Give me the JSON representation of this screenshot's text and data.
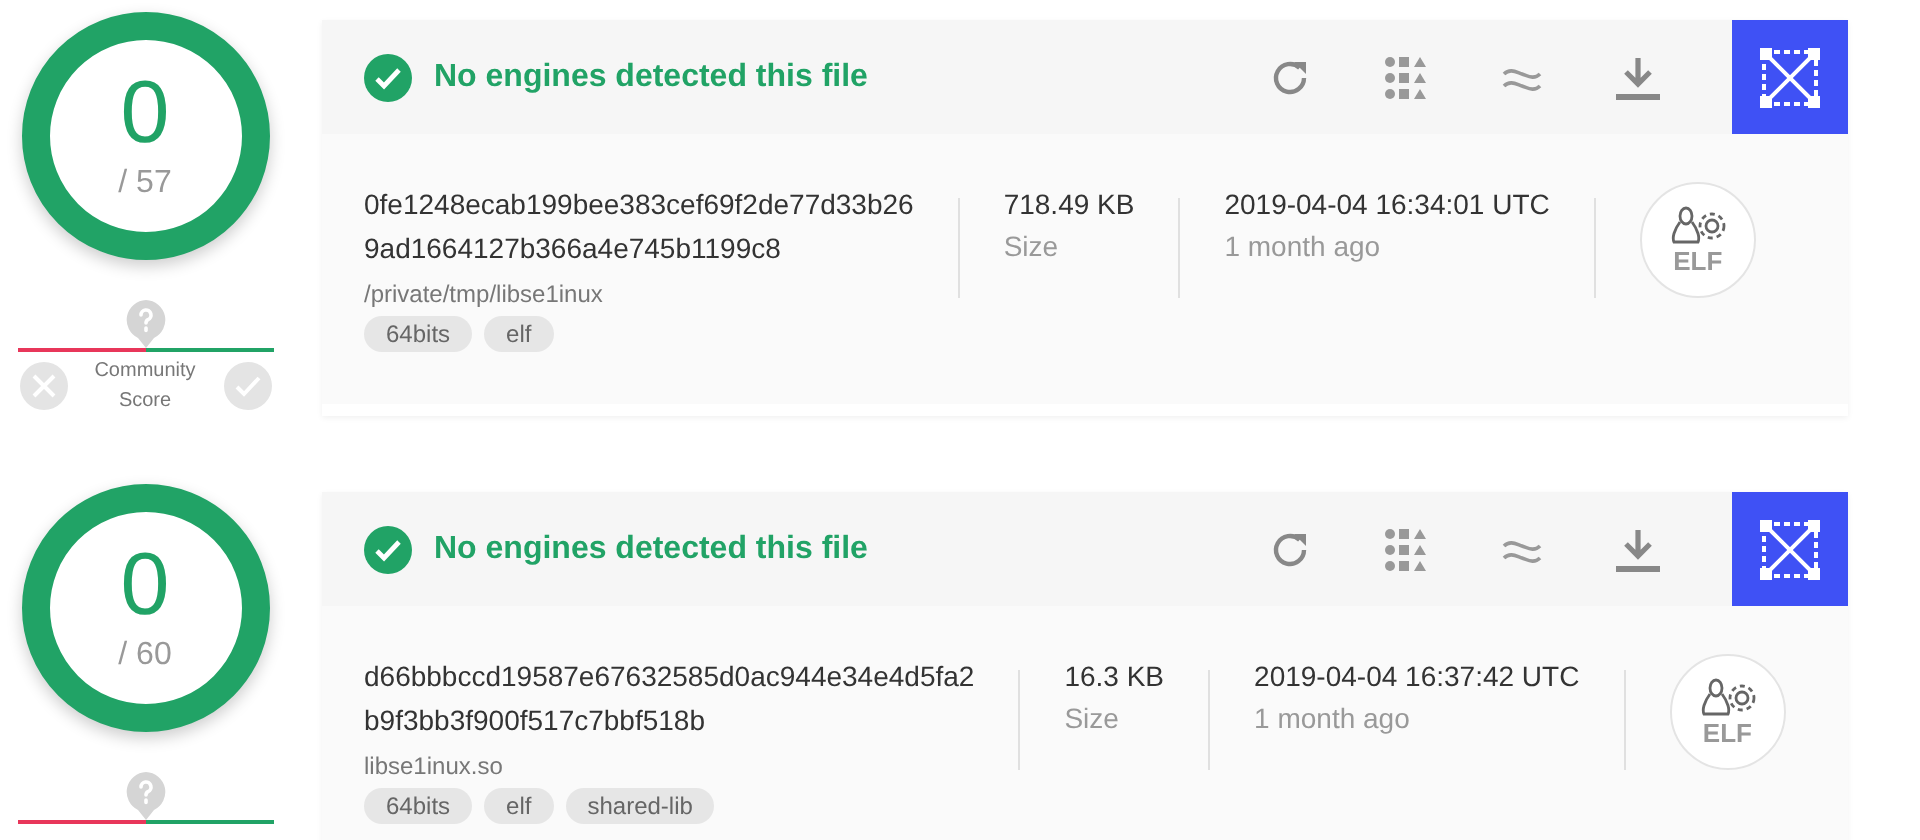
{
  "reports": [
    {
      "detections": "0",
      "engines": "/ 57",
      "community": {
        "label": "Community Score"
      },
      "status": "No engines detected this file",
      "hash_lines": [
        "0fe1248ecab199bee383cef69f2de77d33b26",
        "9ad1664127b366a4e745b1199c8"
      ],
      "path": "/private/tmp/libse1inux",
      "tags": [
        "64bits",
        "elf"
      ],
      "size": "718.49 KB",
      "size_label": "Size",
      "date": "2019-04-04 16:34:01 UTC",
      "age": "1 month ago",
      "file_type": "ELF"
    },
    {
      "detections": "0",
      "engines": "/ 60",
      "status": "No engines detected this file",
      "hash_lines": [
        "d66bbbccd19587e67632585d0ac944e34e4d5fa2",
        "b9f3bb3f900f517c7bbf518b"
      ],
      "path": "libse1inux.so",
      "tags": [
        "64bits",
        "elf",
        "shared-lib"
      ],
      "size": "16.3 KB",
      "size_label": "Size",
      "date": "2019-04-04 16:37:42 UTC",
      "age": "1 month ago",
      "file_type": "ELF"
    }
  ]
}
